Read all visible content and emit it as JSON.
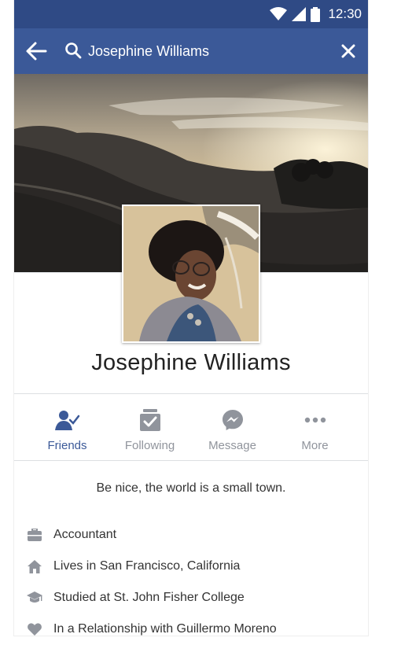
{
  "status_bar": {
    "time": "12:30"
  },
  "search": {
    "value": "Josephine Williams"
  },
  "profile": {
    "name": "Josephine Williams",
    "bio": "Be nice, the world is a small town."
  },
  "actions": [
    {
      "label": "Friends",
      "icon": "friends-check-icon"
    },
    {
      "label": "Following",
      "icon": "following-inbox-icon"
    },
    {
      "label": "Message",
      "icon": "messenger-icon"
    },
    {
      "label": "More",
      "icon": "more-dots-icon"
    }
  ],
  "about": [
    {
      "icon": "briefcase-icon",
      "text": "Accountant"
    },
    {
      "icon": "home-icon",
      "text": "Lives in San Francisco, California"
    },
    {
      "icon": "graduation-cap-icon",
      "text": "Studied at St. John Fisher College"
    },
    {
      "icon": "heart-icon",
      "text": "In a Relationship with Guillermo Moreno"
    }
  ],
  "colors": {
    "header": "#3b5998",
    "status_bar": "#2f4a85",
    "accent": "#3b5998",
    "muted": "#90949c"
  }
}
